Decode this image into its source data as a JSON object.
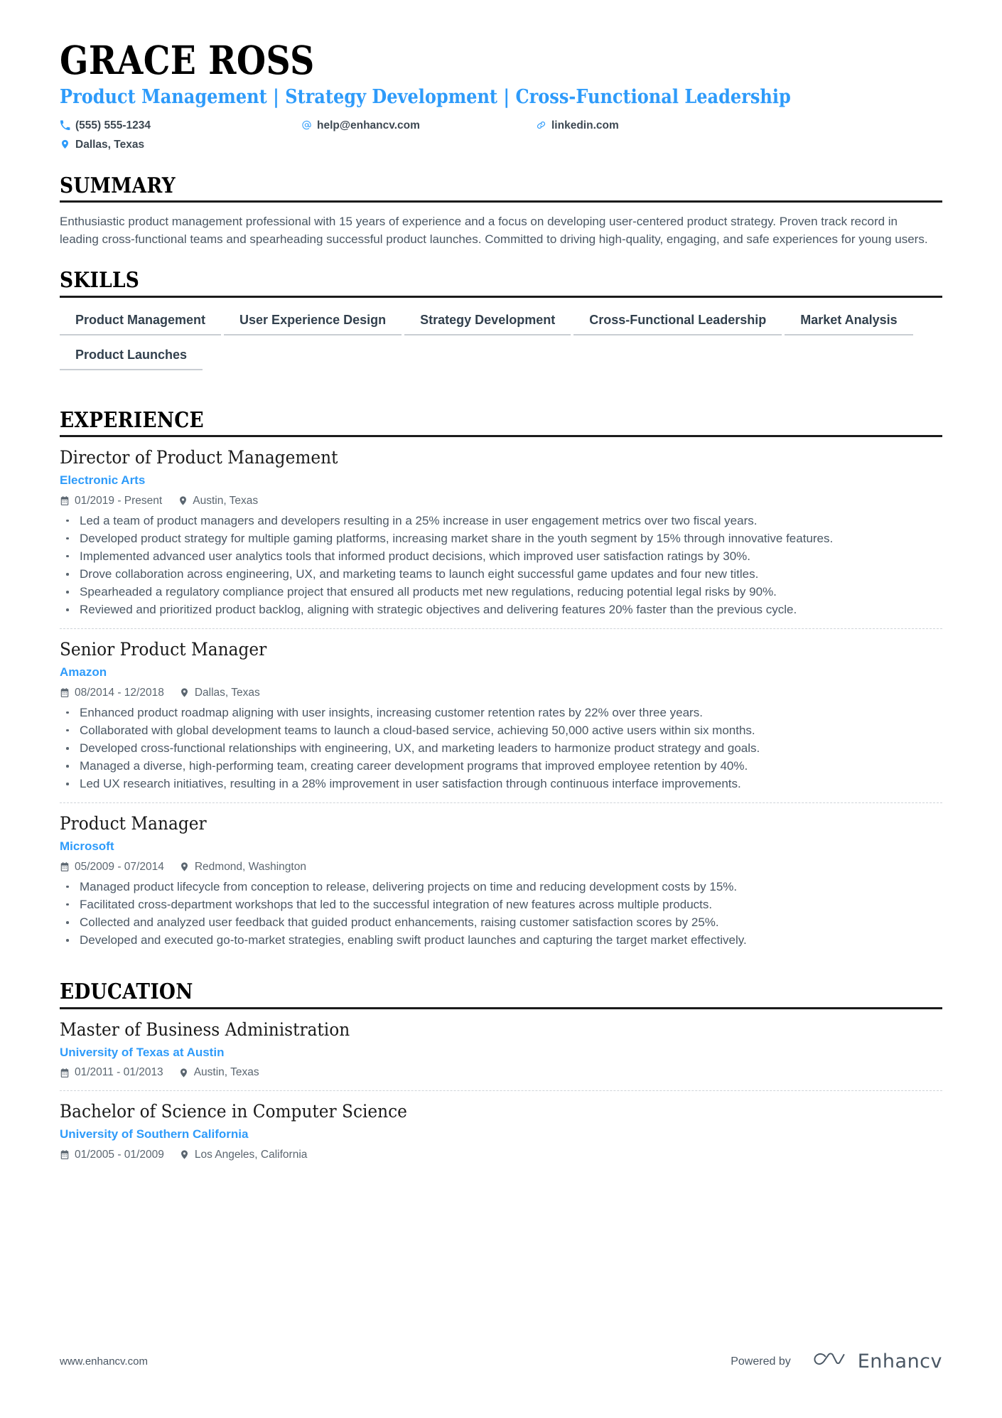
{
  "header": {
    "name": "GRACE ROSS",
    "headline": "Product Management | Strategy Development | Cross-Functional Leadership",
    "contacts": {
      "phone": "(555) 555-1234",
      "email": "help@enhancv.com",
      "website": "linkedin.com",
      "location": "Dallas, Texas"
    },
    "icons": {
      "phone": "phone-icon",
      "email": "at-sign-icon",
      "link": "link-icon",
      "location": "map-pin-icon"
    }
  },
  "accent_color": "#2e9bfa",
  "sections": {
    "summary": {
      "title": "SUMMARY",
      "text": "Enthusiastic product management professional with 15 years of experience and a focus on developing user-centered product strategy. Proven track record in leading cross-functional teams and spearheading successful product launches. Committed to driving high-quality, engaging, and safe experiences for young users."
    },
    "skills": {
      "title": "SKILLS",
      "items": [
        "Product Management",
        "User Experience Design",
        "Strategy Development",
        "Cross-Functional Leadership",
        "Market Analysis",
        "Product Launches"
      ]
    },
    "experience": {
      "title": "EXPERIENCE",
      "entries": [
        {
          "title": "Director of Product Management",
          "org": "Electronic Arts",
          "dates": "01/2019 - Present",
          "location": "Austin, Texas",
          "bullets": [
            "Led a team of product managers and developers resulting in a 25% increase in user engagement metrics over two fiscal years.",
            "Developed product strategy for multiple gaming platforms, increasing market share in the youth segment by 15% through innovative features.",
            "Implemented advanced user analytics tools that informed product decisions, which improved user satisfaction ratings by 30%.",
            "Drove collaboration across engineering, UX, and marketing teams to launch eight successful game updates and four new titles.",
            "Spearheaded a regulatory compliance project that ensured all products met new regulations, reducing potential legal risks by 90%.",
            "Reviewed and prioritized product backlog, aligning with strategic objectives and delivering features 20% faster than the previous cycle."
          ]
        },
        {
          "title": "Senior Product Manager",
          "org": "Amazon",
          "dates": "08/2014 - 12/2018",
          "location": "Dallas, Texas",
          "bullets": [
            "Enhanced product roadmap aligning with user insights, increasing customer retention rates by 22% over three years.",
            "Collaborated with global development teams to launch a cloud-based service, achieving 50,000 active users within six months.",
            "Developed cross-functional relationships with engineering, UX, and marketing leaders to harmonize product strategy and goals.",
            "Managed a diverse, high-performing team, creating career development programs that improved employee retention by 40%.",
            "Led UX research initiatives, resulting in a 28% improvement in user satisfaction through continuous interface improvements."
          ]
        },
        {
          "title": "Product Manager",
          "org": "Microsoft",
          "dates": "05/2009 - 07/2014",
          "location": "Redmond, Washington",
          "bullets": [
            "Managed product lifecycle from conception to release, delivering projects on time and reducing development costs by 15%.",
            "Facilitated cross-department workshops that led to the successful integration of new features across multiple products.",
            "Collected and analyzed user feedback that guided product enhancements, raising customer satisfaction scores by 25%.",
            "Developed and executed go-to-market strategies, enabling swift product launches and capturing the target market effectively."
          ]
        }
      ]
    },
    "education": {
      "title": "EDUCATION",
      "entries": [
        {
          "title": "Master of Business Administration",
          "org": "University of Texas at Austin",
          "dates": "01/2011 - 01/2013",
          "location": "Austin, Texas"
        },
        {
          "title": "Bachelor of Science in Computer Science",
          "org": "University of Southern California",
          "dates": "01/2005 - 01/2009",
          "location": "Los Angeles, California"
        }
      ]
    }
  },
  "footer": {
    "url": "www.enhancv.com",
    "powered_by": "Powered by",
    "brand": "Enhancv"
  }
}
